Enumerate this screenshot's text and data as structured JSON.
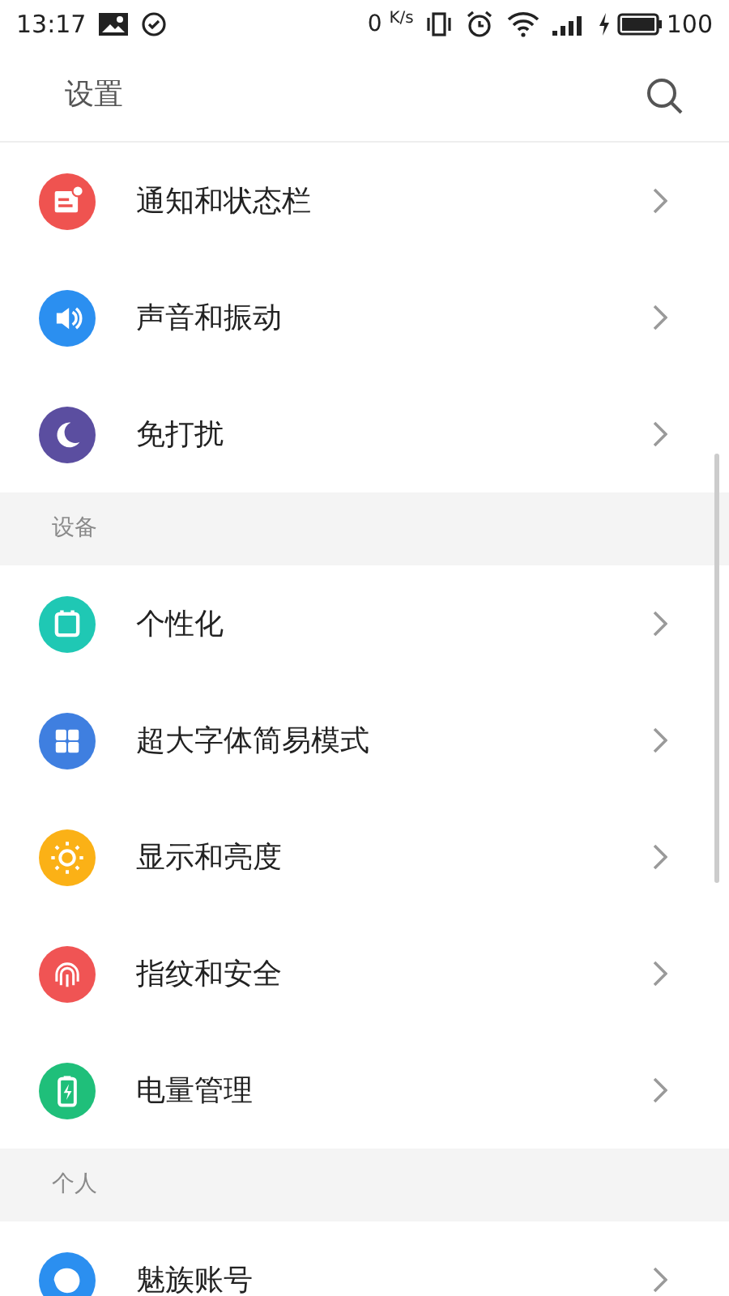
{
  "status_bar": {
    "time": "13:17",
    "speed_value": "0",
    "speed_unit": "K/s",
    "battery": "100"
  },
  "header": {
    "title": "设置"
  },
  "sections": [
    {
      "items": [
        {
          "label": "通知和状态栏",
          "kind": "notice",
          "color": "#ef5350"
        },
        {
          "label": "声音和振动",
          "kind": "sound",
          "color": "#2b8ff0"
        },
        {
          "label": "免打扰",
          "kind": "moon",
          "color": "#5b4ea0"
        }
      ]
    },
    {
      "title": "设备",
      "items": [
        {
          "label": "个性化",
          "kind": "theme",
          "color": "#1fc8b4"
        },
        {
          "label": "超大字体简易模式",
          "kind": "grid",
          "color": "#3f7fe0"
        },
        {
          "label": "显示和亮度",
          "kind": "sun",
          "color": "#fbb116"
        },
        {
          "label": "指纹和安全",
          "kind": "fingerprint",
          "color": "#f05454"
        },
        {
          "label": "电量管理",
          "kind": "battery",
          "color": "#1fbf7a"
        }
      ]
    },
    {
      "title": "个人",
      "items": [
        {
          "label": "魅族账号",
          "kind": "account",
          "color": "#2b8ff0"
        }
      ]
    }
  ]
}
